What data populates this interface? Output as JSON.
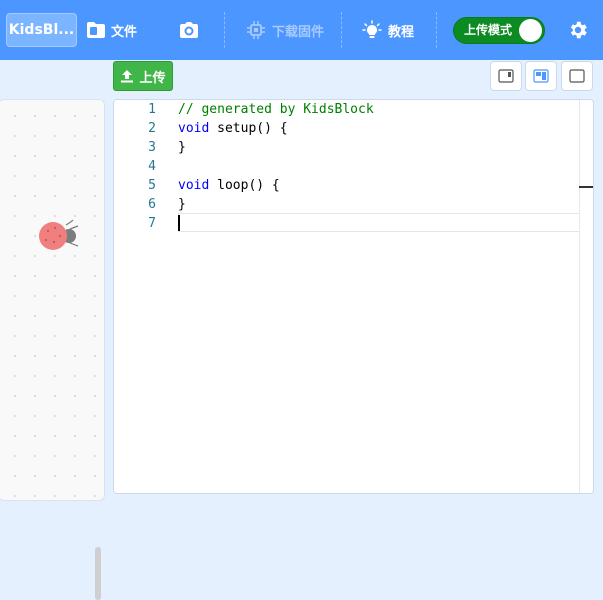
{
  "menubar": {
    "logo_label": "KidsBl...",
    "file_label": "文件",
    "download_firmware_label": "下载固件",
    "tutorial_label": "教程",
    "upload_mode_label": "上传模式",
    "upload_mode_on": true,
    "icons": {
      "file": "folder-icon",
      "screenshot": "camera-icon",
      "firmware": "chip-icon",
      "tutorial": "lightbulb-icon",
      "settings": "gear-icon"
    }
  },
  "toolbar": {
    "upload_label": "上传",
    "view_modes": [
      "layout-right-panel-icon",
      "layout-split-icon",
      "layout-full-icon"
    ],
    "active_view": 1
  },
  "editor": {
    "line_numbers": [
      "1",
      "2",
      "3",
      "4",
      "5",
      "6",
      "7"
    ],
    "lines": [
      [
        {
          "t": "// generated by KidsBlock",
          "c": "comment"
        }
      ],
      [
        {
          "t": "void",
          "c": "kw"
        },
        {
          "t": " setup() {",
          "c": ""
        }
      ],
      [
        {
          "t": "}",
          "c": ""
        }
      ],
      [],
      [
        {
          "t": "void",
          "c": "kw"
        },
        {
          "t": " loop() {",
          "c": ""
        }
      ],
      [
        {
          "t": "}",
          "c": ""
        }
      ],
      []
    ],
    "active_line": 7
  },
  "colors": {
    "menubar": "#4c97ff",
    "upload_button": "#40b649",
    "toggle_on": "#0b8b21",
    "comment": "#008000",
    "keyword": "#0000ff",
    "line_number": "#237893"
  }
}
